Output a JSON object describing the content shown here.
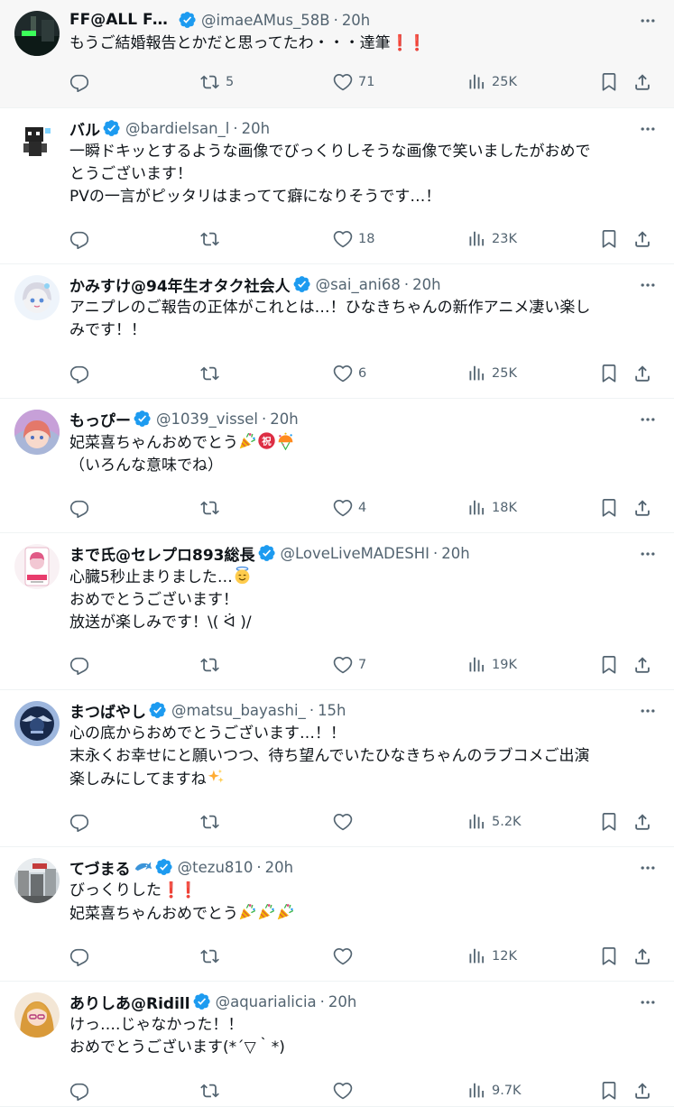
{
  "colors": {
    "verified": "#1d9bf0",
    "text": "#0f1419",
    "muted": "#536471",
    "divider": "#eff3f4",
    "highlight": "#f7f7f7"
  },
  "icons": {
    "reply": "reply-icon",
    "repost": "repost-icon",
    "like": "like-icon",
    "views": "views-icon",
    "bookmark": "bookmark-icon",
    "share": "share-icon",
    "more": "more-icon",
    "verified": "verified-badge-icon"
  },
  "tweets": [
    {
      "name": "FF@ALL For...",
      "handle": "@imaeAMus_58B",
      "sep": "·",
      "time": "20h",
      "lines": [
        "もうご結婚報告とかだと思ってたわ・・・達筆"
      ],
      "replies": "",
      "reposts": "5",
      "likes": "71",
      "views": "25K"
    },
    {
      "name": "バル",
      "handle": "@bardielsan_l",
      "sep": "·",
      "time": "20h",
      "lines": [
        "一瞬ドキッとするような画像でびっくりしそうな画像で笑いましたがおめで",
        "とうございます！",
        "PVの一言がピッタリはまってて癖になりそうです…！"
      ],
      "replies": "",
      "reposts": "",
      "likes": "18",
      "views": "23K"
    },
    {
      "name": "かみすけ@94年生オタク社会人",
      "handle": "@sai_ani68",
      "sep": "·",
      "time": "20h",
      "lines": [
        "アニプレのご報告の正体がこれとは…！ひなきちゃんの新作アニメ凄い楽し",
        "みです！！"
      ],
      "replies": "",
      "reposts": "",
      "likes": "6",
      "views": "25K"
    },
    {
      "name": "もっぴー",
      "handle": "@1039_vissel",
      "sep": "·",
      "time": "20h",
      "lines": [
        "妃菜喜ちゃんおめでとう",
        "（いろんな意味でね）"
      ],
      "replies": "",
      "reposts": "",
      "likes": "4",
      "views": "18K"
    },
    {
      "name": "まで氏@セレプロ893総長",
      "handle": "@LoveLiveMADESHI",
      "sep": "·",
      "time": "20h",
      "lines": [
        "心臓5秒止まりました…",
        "おめでとうございます！",
        "放送が楽しみです！\\( ᐛ )/"
      ],
      "replies": "",
      "reposts": "",
      "likes": "7",
      "views": "19K"
    },
    {
      "name": "まつばやし",
      "handle": "@matsu_bayashi_",
      "sep": "·",
      "time": "15h",
      "lines": [
        "心の底からおめでとうございます…！！",
        "末永くお幸せにと願いつつ、待ち望んでいたひなきちゃんのラブコメご出演",
        "楽しみにしてますね"
      ],
      "replies": "",
      "reposts": "",
      "likes": "",
      "views": "5.2K"
    },
    {
      "name": "てづまる",
      "handle": "@tezu810",
      "sep": "·",
      "time": "20h",
      "lines": [
        "びっくりした",
        "妃菜喜ちゃんおめでとう"
      ],
      "replies": "",
      "reposts": "",
      "likes": "",
      "views": "12K"
    },
    {
      "name": "ありしあ@Ridill",
      "handle": "@aquarialicia",
      "sep": "·",
      "time": "20h",
      "lines": [
        "けっ….じゃなかった！！",
        "おめでとうございます(*´▽｀*)"
      ],
      "replies": "",
      "reposts": "",
      "likes": "",
      "views": "9.7K"
    }
  ]
}
